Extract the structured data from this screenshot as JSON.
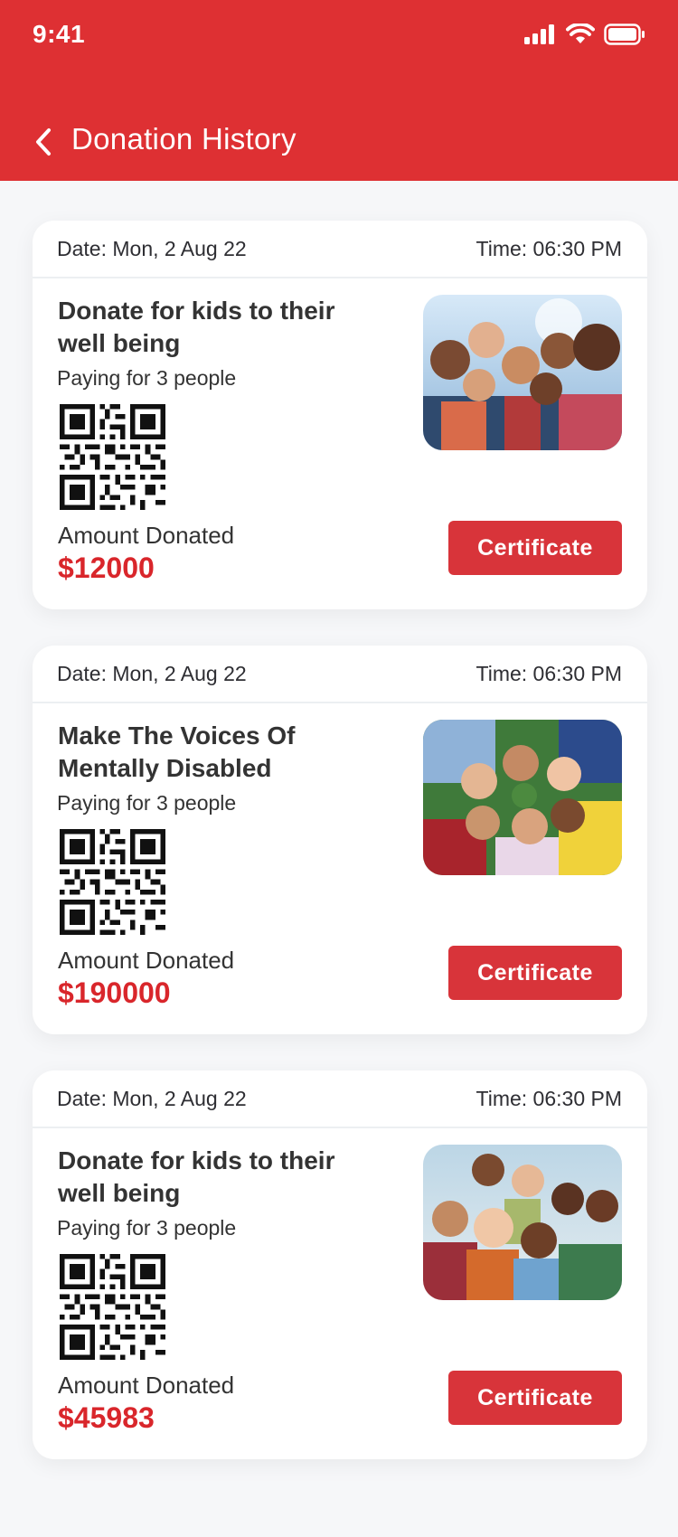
{
  "status_bar": {
    "time": "9:41"
  },
  "header": {
    "title": "Donation History"
  },
  "colors": {
    "primary": "#de3033",
    "amount": "#d9262b",
    "button": "#d8343a"
  },
  "donations": [
    {
      "date": "Date: Mon, 2 Aug 22",
      "time": "Time: 06:30 PM",
      "title": "Donate for kids to their well being",
      "paying": "Paying for 3 people",
      "amount_label": "Amount Donated",
      "amount": "$12000",
      "button_label": "Certificate",
      "image": "group-of-smiling-kids-photo"
    },
    {
      "date": "Date: Mon, 2 Aug 22",
      "time": "Time: 06:30 PM",
      "title": "Make The Voices Of Mentally Disabled",
      "paying": "Paying for 3 people",
      "amount_label": "Amount Donated",
      "amount": "$190000",
      "button_label": "Certificate",
      "image": "kids-lying-in-circle-photo"
    },
    {
      "date": "Date: Mon, 2 Aug 22",
      "time": "Time: 06:30 PM",
      "title": "Donate for kids to their well being",
      "paying": "Paying for 3 people",
      "amount_label": "Amount Donated",
      "amount": "$45983",
      "button_label": "Certificate",
      "image": "kids-group-laughing-photo"
    }
  ]
}
